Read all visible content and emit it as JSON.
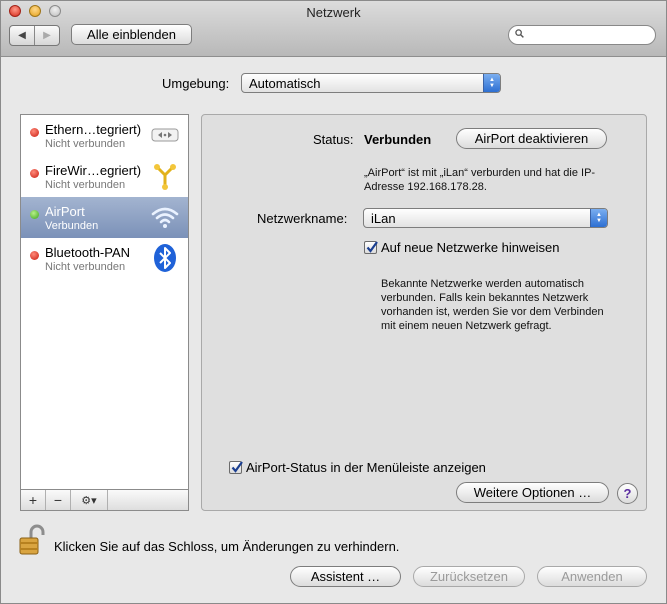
{
  "window": {
    "title": "Netzwerk"
  },
  "toolbar": {
    "show_all_label": "Alle einblenden",
    "search_placeholder": ""
  },
  "location": {
    "label": "Umgebung:",
    "value": "Automatisch"
  },
  "services": [
    {
      "name": "Ethern…tegriert)",
      "status": "Nicht verbunden",
      "status_color": "red",
      "icon": "ethernet-icon"
    },
    {
      "name": "FireWir…egriert)",
      "status": "Nicht verbunden",
      "status_color": "red",
      "icon": "firewire-icon"
    },
    {
      "name": "AirPort",
      "status": "Verbunden",
      "status_color": "green",
      "icon": "airport-wifi-icon",
      "selected": true
    },
    {
      "name": "Bluetooth-PAN",
      "status": "Nicht verbunden",
      "status_color": "red",
      "icon": "bluetooth-icon"
    }
  ],
  "sidebar_bar": {
    "add": "+",
    "remove": "−",
    "action": "⚙▾"
  },
  "detail": {
    "status_label": "Status:",
    "status_value": "Verbunden",
    "toggle_button": "AirPort deaktivieren",
    "status_desc_line1": "„AirPort“ ist mit „iLan“ verburden und hat die IP-",
    "status_desc_line2": "Adresse 192.168.178.28.",
    "network_name_label": "Netzwerkname:",
    "network_name_value": "iLan",
    "ask_new_networks_label": "Auf neue Netzwerke hinweisen",
    "ask_new_networks_checked": true,
    "info_lines": [
      "Bekannte Netzwerke werden automatisch",
      "verbunden. Falls kein bekanntes Netzwerk",
      "vorhanden ist, werden Sie vor dem Verbinden",
      "mit einem neuen Netzwerk gefragt."
    ],
    "menubar_status_label": "AirPort-Status in der Menüleiste anzeigen",
    "menubar_status_checked": true,
    "advanced_button": "Weitere Optionen …",
    "help": "?"
  },
  "footer": {
    "lock_text": "Klicken Sie auf das Schloss, um Änderungen zu verhindern.",
    "assistant_button": "Assistent …",
    "revert_button": "Zurücksetzen",
    "apply_button": "Anwenden"
  },
  "colors": {
    "selection": "#7b91b8",
    "accent": "#2d6fd2",
    "help": "#5a2ca0"
  }
}
